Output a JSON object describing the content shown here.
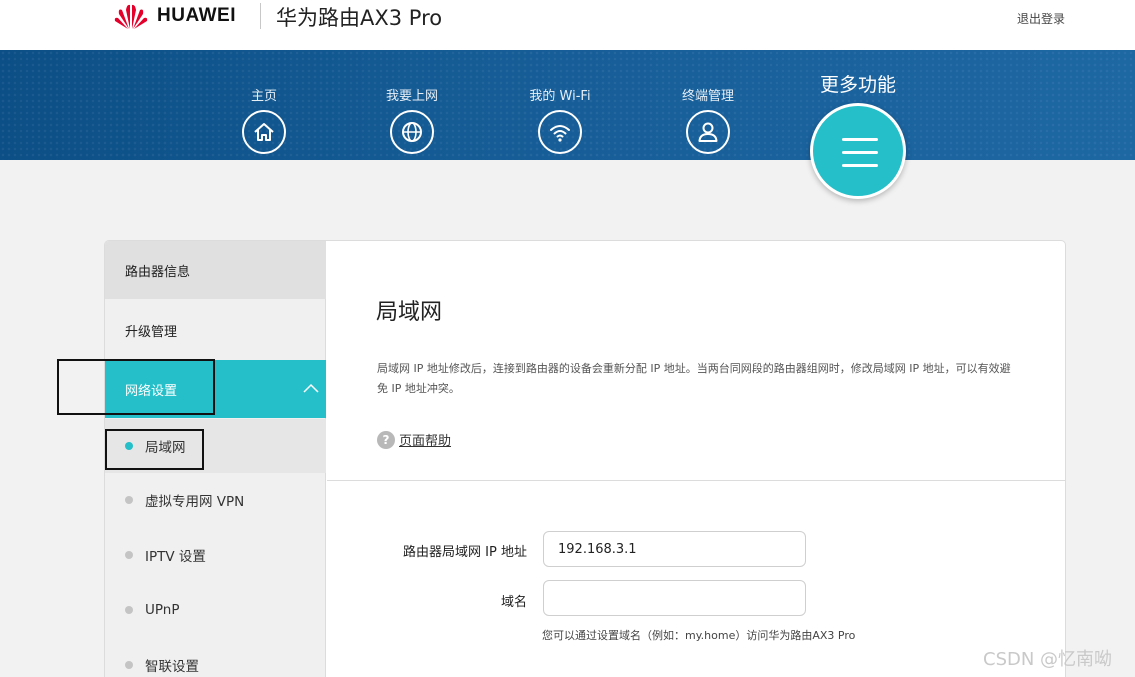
{
  "header": {
    "brand": "HUAWEI",
    "product": "华为路由AX3 Pro",
    "logout": "退出登录"
  },
  "nav": {
    "items": [
      {
        "label": "主页",
        "icon": "home-icon"
      },
      {
        "label": "我要上网",
        "icon": "globe-icon"
      },
      {
        "label": "我的 Wi-Fi",
        "icon": "wifi-icon"
      },
      {
        "label": "终端管理",
        "icon": "user-icon"
      }
    ],
    "more_label": "更多功能",
    "more_icon": "menu-icon"
  },
  "sidebar": {
    "items": [
      {
        "label": "路由器信息"
      },
      {
        "label": "升级管理"
      },
      {
        "label": "网络设置",
        "expanded": true
      }
    ],
    "sub_items": [
      {
        "label": "局域网",
        "active": true
      },
      {
        "label": "虚拟专用网 VPN"
      },
      {
        "label": "IPTV 设置"
      },
      {
        "label": "UPnP"
      },
      {
        "label": "智联设置"
      }
    ]
  },
  "main": {
    "title": "局域网",
    "description": "局域网 IP 地址修改后，连接到路由器的设备会重新分配 IP 地址。当两台同网段的路由器组网时，修改局域网 IP 地址，可以有效避免 IP 地址冲突。",
    "help": "页面帮助",
    "form": {
      "ip_label": "路由器局域网 IP 地址",
      "ip_value": "192.168.3.1",
      "domain_label": "域名",
      "domain_value": "",
      "hint": "您可以通过设置域名（例如：my.home）访问华为路由AX3 Pro"
    }
  },
  "watermark": "CSDN @忆南呦",
  "colors": {
    "accent": "#24bfc8",
    "nav_blue": "#175e98"
  }
}
